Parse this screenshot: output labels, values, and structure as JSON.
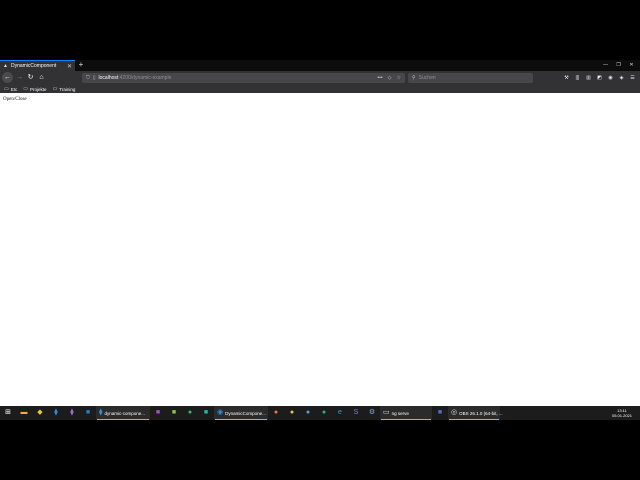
{
  "browser": {
    "tab": {
      "title": "DynamicComponent"
    },
    "url": {
      "host": "localhost",
      "path": ":4200/dynamic-example"
    },
    "search": {
      "placeholder": "Suchen"
    },
    "bookmarks": [
      {
        "label": "Etc"
      },
      {
        "label": "Projekte"
      },
      {
        "label": "Training"
      }
    ]
  },
  "page": {
    "toggle_text": "Open/Close"
  },
  "taskbar": {
    "items": [
      {
        "label": "dynamic-compone..."
      },
      {
        "label": "DynamicCompone..."
      },
      {
        "label": "ng serve"
      },
      {
        "label": "OBS 26.1.0 (64-bit, ..."
      }
    ],
    "clock": {
      "time": "13:11",
      "date": "05.01.2021"
    }
  },
  "colors": {
    "accent": "#0a84ff",
    "taskbar_indicator": "#76b9ed"
  }
}
